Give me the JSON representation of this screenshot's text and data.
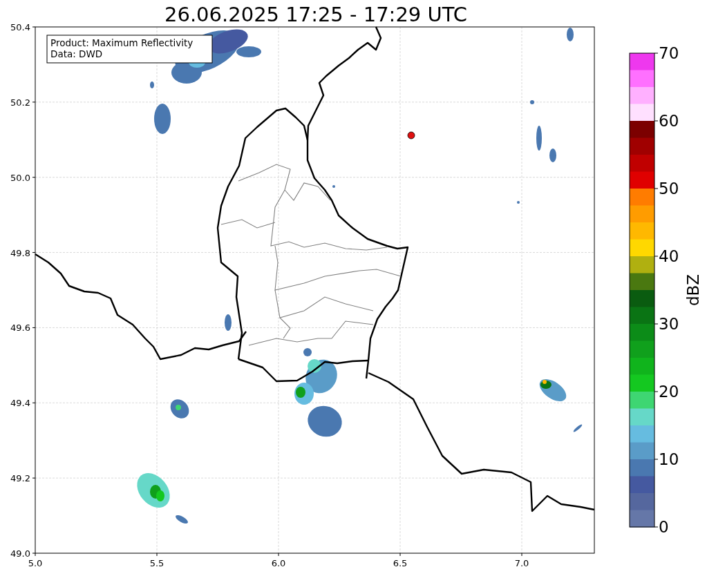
{
  "title": "26.06.2025 17:25 - 17:29 UTC",
  "info_box": {
    "lines": [
      "Product: Maximum Reflectivity",
      "Data: DWD"
    ]
  },
  "map": {
    "x_ticks": [
      "5.0",
      "5.5",
      "6.0",
      "6.5",
      "7.0"
    ],
    "y_ticks": [
      "50.4",
      "50.2",
      "50.0",
      "49.8",
      "49.6",
      "49.4",
      "49.2",
      "49.0"
    ]
  },
  "colorbar": {
    "label": "dBZ",
    "ticks": [
      "70",
      "60",
      "50",
      "40",
      "30",
      "20",
      "10",
      "0"
    ],
    "segments": [
      {
        "color": "#ee38ee"
      },
      {
        "color": "#ff70ff"
      },
      {
        "color": "#ffb0ff"
      },
      {
        "color": "#ffe0ff"
      },
      {
        "color": "#7c0000"
      },
      {
        "color": "#a00000"
      },
      {
        "color": "#c00000"
      },
      {
        "color": "#e00000"
      },
      {
        "color": "#ff7c00"
      },
      {
        "color": "#ff9c00"
      },
      {
        "color": "#ffb800"
      },
      {
        "color": "#ffd800"
      },
      {
        "color": "#b0b010"
      },
      {
        "color": "#4a7810"
      },
      {
        "color": "#0a5c10"
      },
      {
        "color": "#0a7414"
      },
      {
        "color": "#0c8c18"
      },
      {
        "color": "#10a01c"
      },
      {
        "color": "#10b41c"
      },
      {
        "color": "#14c820"
      },
      {
        "color": "#3ed672"
      },
      {
        "color": "#66d8c8"
      },
      {
        "color": "#66bce0"
      },
      {
        "color": "#5a9cc8"
      },
      {
        "color": "#4a78b0"
      },
      {
        "color": "#4559a0"
      },
      {
        "color": "#55679e"
      },
      {
        "color": "#6577a8"
      }
    ]
  }
}
